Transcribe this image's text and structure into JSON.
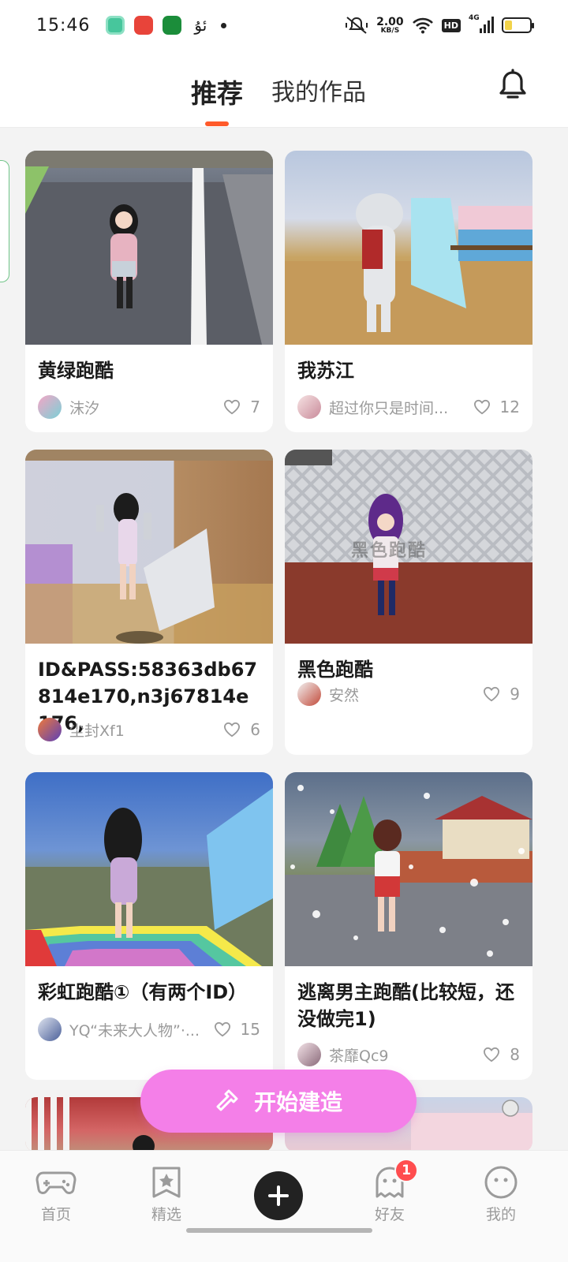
{
  "status_bar": {
    "time": "15:46",
    "glyph": "ئۇ",
    "speed_value": "2.00",
    "speed_unit": "KB/S",
    "network": "4G",
    "hd": "HD"
  },
  "header": {
    "tabs": [
      {
        "label": "推荐",
        "active": true
      },
      {
        "label": "我的作品",
        "active": false
      }
    ],
    "accent": "#ff5a2a"
  },
  "cards": [
    {
      "title": "黄绿跑酷",
      "author": "沫汐",
      "likes": "7"
    },
    {
      "title": "我苏江",
      "author": "超过你只是时间...",
      "likes": "12"
    },
    {
      "title": "ID&PASS:58363db67814e170,n3j67814e176,",
      "author": "尘封Xf1",
      "likes": "6"
    },
    {
      "title": "黑色跑酷",
      "author": "安然",
      "likes": "9",
      "watermark": "黑色跑酷"
    },
    {
      "title": "彩虹跑酷①（有两个ID）",
      "author": "YQ“未来大人物”·...",
      "likes": "15"
    },
    {
      "title": "逃离男主跑酷(比较短，还没做完1)",
      "author": "茶靡Qc9",
      "likes": "8"
    }
  ],
  "build_button": {
    "label": "开始建造",
    "color": "#f47fe8"
  },
  "bottom_nav": {
    "items": [
      {
        "label": "首页",
        "icon": "gamepad-icon"
      },
      {
        "label": "精选",
        "icon": "star-bookmark-icon"
      },
      {
        "label": "",
        "icon": "plus-icon"
      },
      {
        "label": "好友",
        "icon": "ghost-icon"
      },
      {
        "label": "我的",
        "icon": "smile-icon"
      }
    ],
    "friends_badge": "1"
  }
}
